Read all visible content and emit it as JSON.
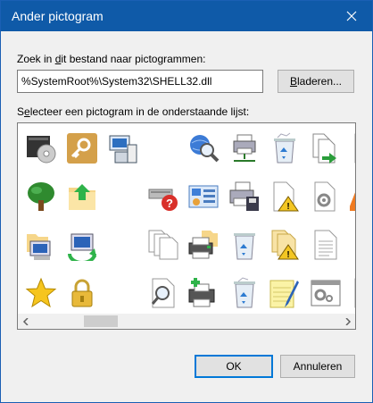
{
  "window": {
    "title": "Ander pictogram"
  },
  "file_field": {
    "label_pre": "Zoek in ",
    "label_accel": "d",
    "label_post": "it bestand naar pictogrammen:",
    "value": "%SystemRoot%\\System32\\SHELL32.dll"
  },
  "browse_button": {
    "pre": "",
    "accel": "B",
    "post": "laderen..."
  },
  "list_label": {
    "pre": "S",
    "accel": "e",
    "post": "lecteer een pictogram in de onderstaande lijst:"
  },
  "icons": [
    "dvd-drive-icon",
    "key-icon",
    "network-computer-icon",
    "blank-icon",
    "search-globe-icon",
    "network-printer-icon",
    "recycle-bin-full-icon",
    "document-arrow-icon",
    "gear-document-icon",
    "tree-icon",
    "folder-up-icon",
    "blank-icon",
    "drive-error-icon",
    "control-panel-icon",
    "printer-disk-icon",
    "document-warning-icon",
    "gear-document-icon",
    "warning-icon",
    "computer-folder-icon",
    "sync-computer-icon",
    "blank-icon",
    "documents-stack-icon",
    "printer-folder-icon",
    "recycle-bin-empty-icon",
    "folder-warning-icon",
    "text-document-icon",
    "font-icon",
    "star-icon",
    "padlock-icon",
    "blank-icon",
    "search-document-icon",
    "add-printer-icon",
    "recycle-bin-icon",
    "notepad-pen-icon",
    "window-gear-icon",
    "presentation-icon"
  ],
  "ok_button": "OK",
  "cancel_button": "Annuleren"
}
